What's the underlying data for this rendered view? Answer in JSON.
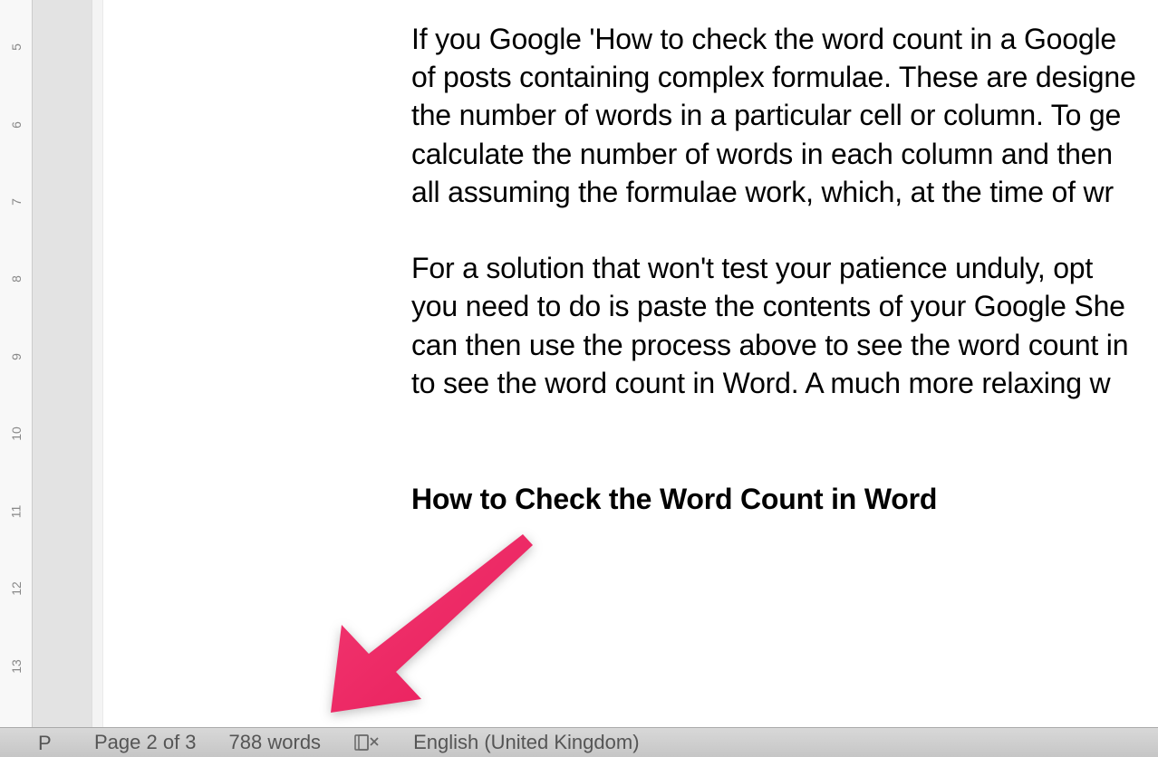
{
  "ruler": {
    "labels": [
      "5",
      "6",
      "7",
      "8",
      "9",
      "10",
      "11",
      "12",
      "13"
    ]
  },
  "document": {
    "paragraph1": {
      "line1": "If you Google 'How to check the word count in a Google",
      "line2": "of posts containing complex formulae. These are designe",
      "line3": "the number of words in a particular cell or column. To ge",
      "line4": "calculate the number of words in each column and then ",
      "line5": "all assuming the formulae work, which, at the time of wr"
    },
    "paragraph2": {
      "line1": "For a solution that won't test your patience unduly, opt ",
      "line2": "you need to do is paste the contents of your Google She",
      "line3": "can then use the process above to see the word count in",
      "line4": "to see the word count in Word. A much more relaxing w"
    },
    "heading": "How to Check the Word Count in Word"
  },
  "status_bar": {
    "corner_letter": "P",
    "page": "Page 2 of 3",
    "words": "788 words",
    "language": "English (United Kingdom)"
  },
  "annotation": {
    "arrow_color": "#ed2a64"
  }
}
